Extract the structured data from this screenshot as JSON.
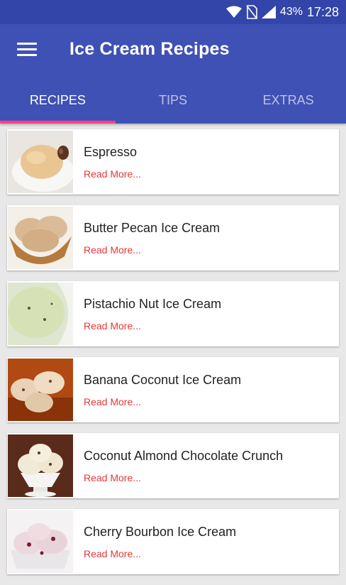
{
  "status": {
    "battery": "43%",
    "time": "17:28"
  },
  "app": {
    "title": "Ice Cream Recipes"
  },
  "tabs": [
    {
      "label": "RECIPES",
      "active": true
    },
    {
      "label": "TIPS",
      "active": false
    },
    {
      "label": "EXTRAS",
      "active": false
    }
  ],
  "recipes": [
    {
      "title": "Espresso",
      "link": "Read More..."
    },
    {
      "title": "Butter Pecan Ice Cream",
      "link": "Read More..."
    },
    {
      "title": "Pistachio Nut Ice Cream",
      "link": "Read More..."
    },
    {
      "title": "Banana Coconut Ice Cream",
      "link": "Read More..."
    },
    {
      "title": "Coconut Almond Chocolate Crunch",
      "link": "Read More..."
    },
    {
      "title": "Cherry Bourbon Ice Cream",
      "link": "Read More..."
    }
  ],
  "colors": {
    "statusbar": "#3345a8",
    "primary": "#3f51b5",
    "accent": "#ff4081",
    "link": "#e53935"
  }
}
